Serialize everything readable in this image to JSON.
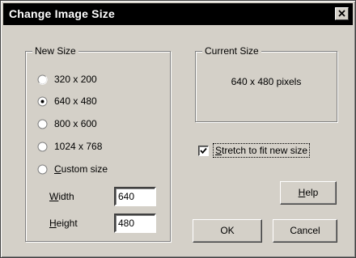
{
  "window": {
    "title": "Change Image Size",
    "close_icon": "close-icon"
  },
  "new_size": {
    "group_label": "New Size",
    "options": [
      {
        "label": "320 x 200",
        "selected": false
      },
      {
        "label": "640 x 480",
        "selected": true
      },
      {
        "label": "800 x 600",
        "selected": false
      },
      {
        "label": "1024 x 768",
        "selected": false
      },
      {
        "label": "Custom size",
        "selected": false,
        "mnemonic": "C"
      }
    ],
    "width_label": "Width",
    "width_mnemonic": "W",
    "width_value": "640",
    "height_label": "Height",
    "height_mnemonic": "H",
    "height_value": "480"
  },
  "current_size": {
    "group_label": "Current Size",
    "value": "640 x 480 pixels"
  },
  "stretch": {
    "label": "Stretch to fit new size",
    "mnemonic": "S",
    "checked": true
  },
  "buttons": {
    "help": "Help",
    "help_mnemonic": "H",
    "ok": "OK",
    "cancel": "Cancel"
  }
}
